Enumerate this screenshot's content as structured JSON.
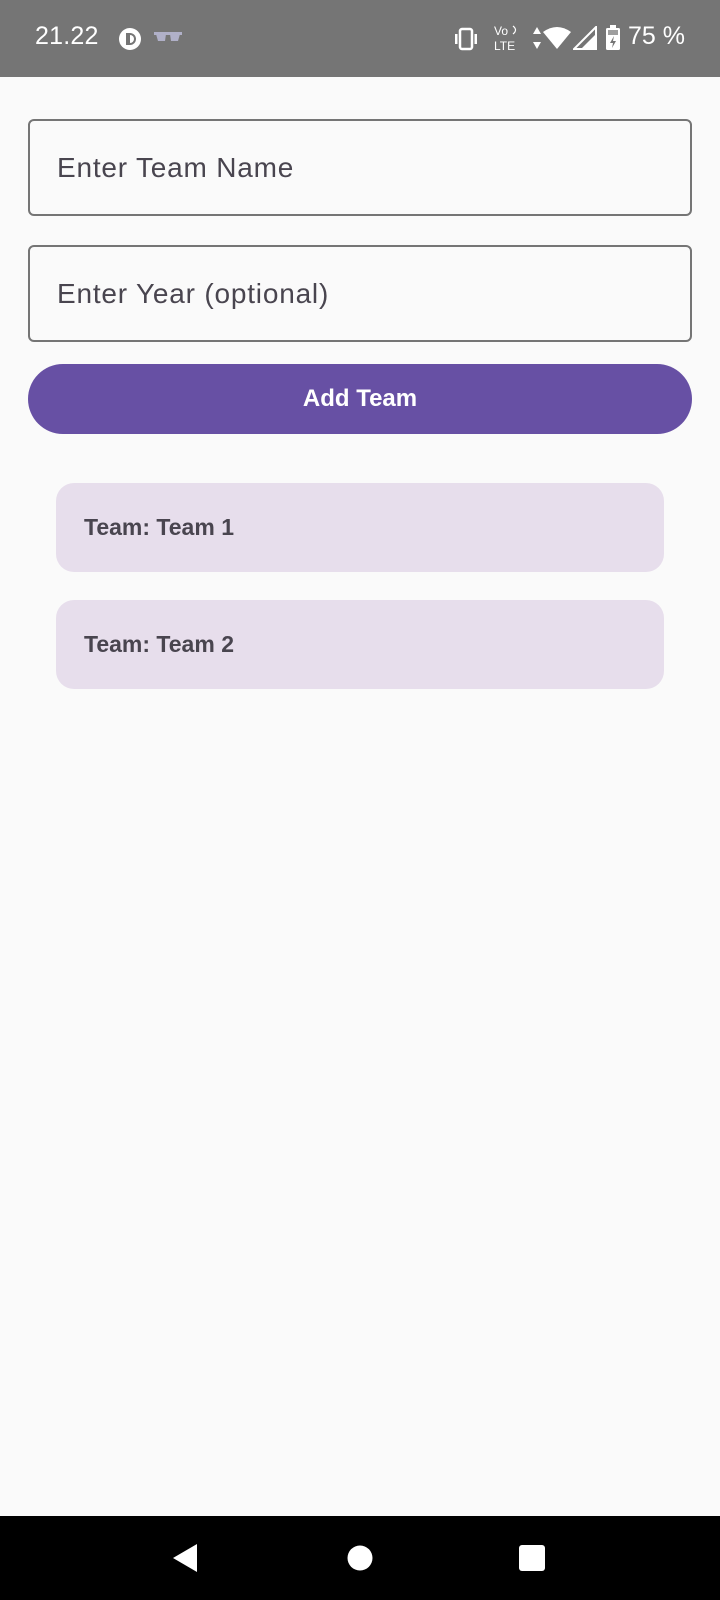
{
  "status_bar": {
    "time": "21.22",
    "battery": "75 %",
    "icons": [
      "data-saver-icon",
      "glasses-icon",
      "vibrate-icon",
      "volte-icon",
      "data-arrows-icon",
      "wifi-icon",
      "signal-icon",
      "battery-icon"
    ]
  },
  "form": {
    "team_name": {
      "placeholder": "Enter Team Name",
      "value": ""
    },
    "year": {
      "placeholder": "Enter Year (optional)",
      "value": ""
    },
    "add_button_label": "Add Team"
  },
  "teams": [
    {
      "label": "Team: Team 1"
    },
    {
      "label": "Team: Team 2"
    }
  ],
  "nav": {
    "icons": [
      "back-icon",
      "home-icon",
      "recents-icon"
    ]
  },
  "colors": {
    "status_bar": "#757575",
    "primary": "#6750a4",
    "card": "#e7deec",
    "background": "#fafafa"
  }
}
